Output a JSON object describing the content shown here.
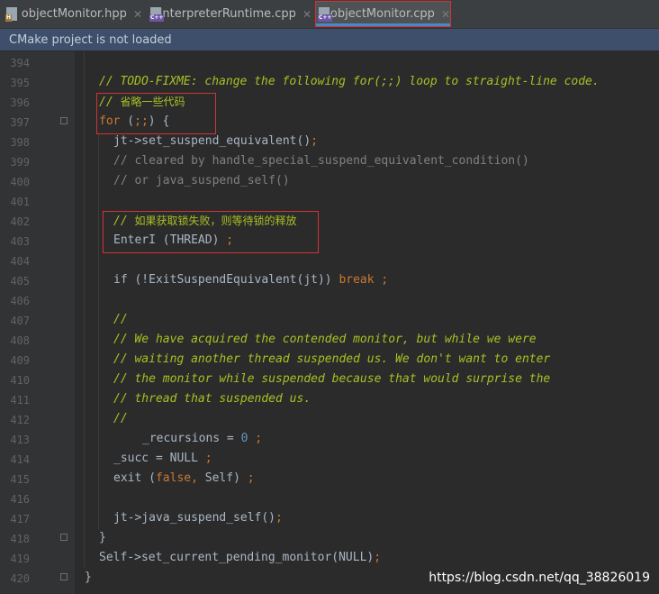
{
  "tabs": [
    {
      "label": "objectMonitor.hpp",
      "type": "hpp",
      "badge": "H",
      "active": false
    },
    {
      "label": "interpreterRuntime.cpp",
      "type": "cpp",
      "badge": "C++",
      "active": false
    },
    {
      "label": "objectMonitor.cpp",
      "type": "cpp",
      "badge": "C++",
      "active": true
    }
  ],
  "tab_close_glyph": "✕",
  "notification": "CMake project is not loaded",
  "line_numbers": [
    "394",
    "395",
    "396",
    "397",
    "398",
    "399",
    "400",
    "401",
    "402",
    "403",
    "404",
    "405",
    "406",
    "407",
    "408",
    "409",
    "410",
    "411",
    "412",
    "413",
    "414",
    "415",
    "416",
    "417",
    "418",
    "419",
    "420"
  ],
  "code": {
    "l395_comment": "// ",
    "l395_todo": "TODO-FIXME: change the following for(;;) loop to straight-line code.",
    "l396_slash": "// ",
    "l396_cn": "省略一些代码",
    "l397_for": "for",
    "l397_paren_open": " (",
    "l397_semis": ";;",
    "l397_rest": ") {",
    "l398_text": "jt->set_suspend_equivalent()",
    "l398_semi": ";",
    "l399_text": "// cleared by handle_special_suspend_equivalent_condition()",
    "l400_text": "// or java_suspend_self()",
    "l402_slash": "// ",
    "l402_cn": "如果获取锁失败，则等待锁的释放",
    "l403_text": "EnterI (THREAD) ",
    "l403_semi": ";",
    "l405_text": "if (!ExitSuspendEquivalent(jt)) ",
    "l405_break": "break",
    "l405_semi": " ;",
    "l407_text": "//",
    "l408_text": "// We have acquired the contended monitor, but while we were",
    "l409_text": "// waiting another thread suspended us. We don't want to enter",
    "l410_text": "// the monitor while suspended because that would surprise the",
    "l411_text": "// thread that suspended us.",
    "l412_text": "//",
    "l413_text": "_recursions = ",
    "l413_num": "0",
    "l413_semi": " ;",
    "l414_text": "_succ = NULL ",
    "l414_semi": ";",
    "l415_exit": "exit (",
    "l415_false": "false",
    "l415_comma": ",",
    "l415_rest": " Self) ",
    "l415_semi": ";",
    "l417_text": "jt->java_suspend_self()",
    "l417_semi": ";",
    "l418_text": "}",
    "l419_text": "Self->set_current_pending_monitor(NULL)",
    "l419_semi": ";",
    "l420_text": "}"
  },
  "watermark": "https://blog.csdn.net/qq_38826019",
  "colors": {
    "editor_bg": "#2b2b2b",
    "keyword": "#cc7832",
    "comment": "#808080",
    "todo": "#a8c023",
    "number": "#6897bb",
    "highlight_box": "#d23333",
    "notice_bg": "#3d4f6b"
  }
}
